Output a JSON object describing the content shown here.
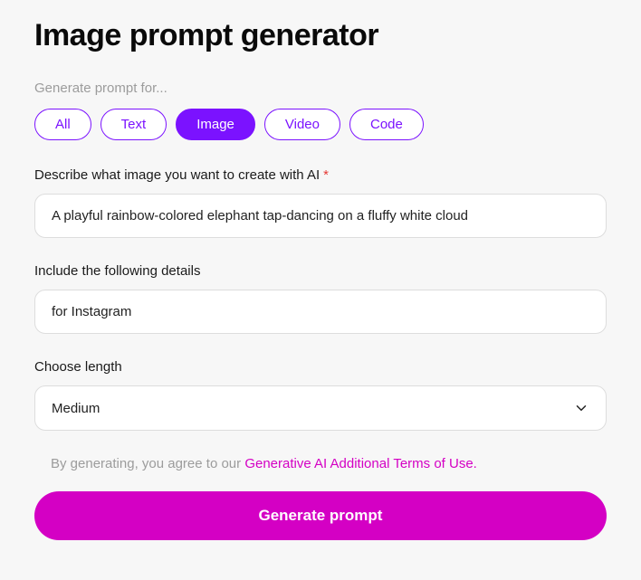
{
  "title": "Image prompt generator",
  "promptFor": {
    "label": "Generate prompt for...",
    "options": [
      "All",
      "Text",
      "Image",
      "Video",
      "Code"
    ],
    "active": "Image"
  },
  "describe": {
    "label": "Describe what image you want to create with AI",
    "required_marker": "*",
    "value": "A playful rainbow-colored elephant tap-dancing on a fluffy white cloud"
  },
  "details": {
    "label": "Include the following details",
    "value": "for Instagram"
  },
  "length": {
    "label": "Choose length",
    "value": "Medium"
  },
  "disclaimer": {
    "prefix": "By generating, you agree to our ",
    "link": "Generative AI Additional Terms of Use."
  },
  "generate_label": "Generate prompt"
}
